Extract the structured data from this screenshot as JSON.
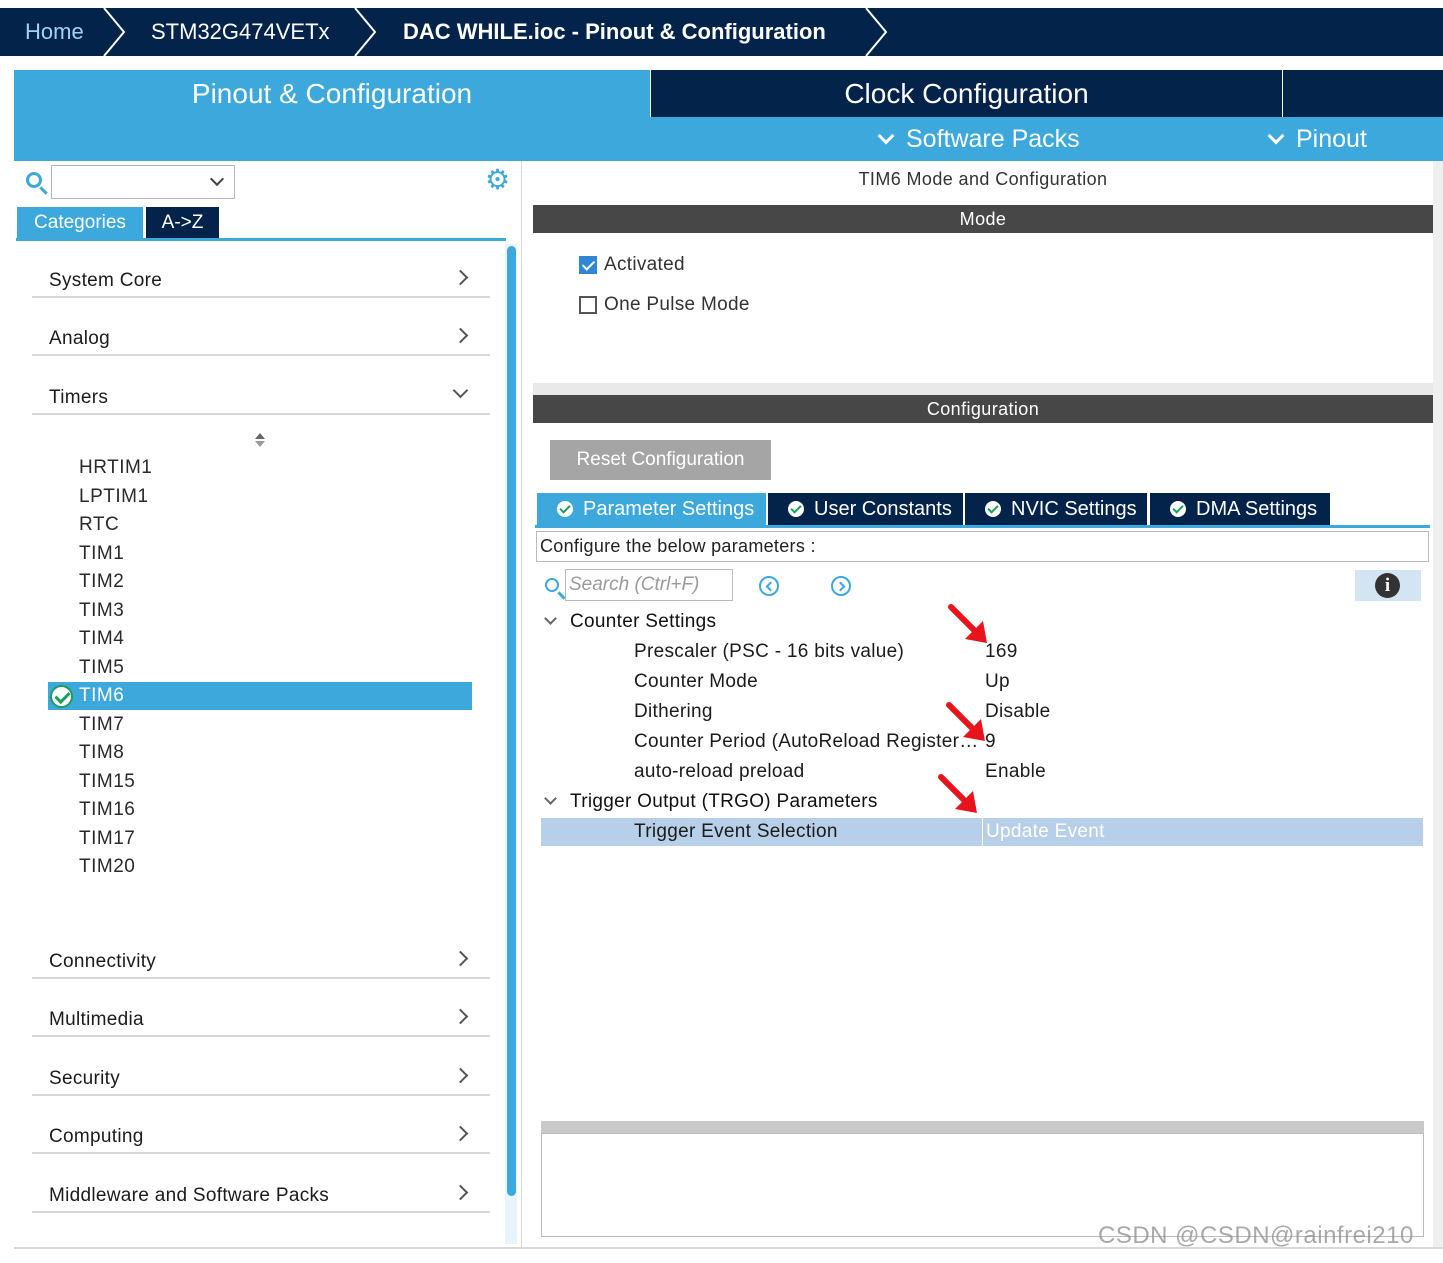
{
  "breadcrumb": {
    "home": "Home",
    "device": "STM32G474VETx",
    "project": "DAC WHILE.ioc - Pinout & Configuration"
  },
  "main_tabs": {
    "pinout_config": "Pinout & Configuration",
    "clock_config": "Clock Configuration"
  },
  "sub_menu": {
    "software_packs": "Software Packs",
    "pinout": "Pinout"
  },
  "left": {
    "search_value": "",
    "tab_categories": "Categories",
    "tab_az": "A->Z",
    "categories": [
      {
        "label": "System Core",
        "expanded": false
      },
      {
        "label": "Analog",
        "expanded": false
      },
      {
        "label": "Timers",
        "expanded": true
      },
      {
        "label": "Connectivity",
        "expanded": false
      },
      {
        "label": "Multimedia",
        "expanded": false
      },
      {
        "label": "Security",
        "expanded": false
      },
      {
        "label": "Computing",
        "expanded": false
      },
      {
        "label": "Middleware and Software Packs",
        "expanded": false
      }
    ],
    "timers": [
      "HRTIM1",
      "LPTIM1",
      "RTC",
      "TIM1",
      "TIM2",
      "TIM3",
      "TIM4",
      "TIM5",
      "TIM6",
      "TIM7",
      "TIM8",
      "TIM15",
      "TIM16",
      "TIM17",
      "TIM20"
    ],
    "selected_timer": "TIM6"
  },
  "right": {
    "title": "TIM6 Mode and Configuration",
    "mode_header": "Mode",
    "mode_options": [
      {
        "label": "Activated",
        "checked": true
      },
      {
        "label": "One Pulse Mode",
        "checked": false
      }
    ],
    "config_header": "Configuration",
    "reset_button": "Reset Configuration",
    "param_tabs": [
      "Parameter Settings",
      "User Constants",
      "NVIC Settings",
      "DMA Settings"
    ],
    "active_param_tab": "Parameter Settings",
    "hint": "Configure the below parameters :",
    "search_placeholder": "Search (Ctrl+F)",
    "info_icon": "i",
    "groups": [
      {
        "label": "Counter Settings",
        "params": [
          {
            "name": "Prescaler (PSC - 16 bits value)",
            "value": "169"
          },
          {
            "name": "Counter Mode",
            "value": "Up"
          },
          {
            "name": "Dithering",
            "value": "Disable"
          },
          {
            "name": "Counter Period (AutoReload Register - 16 bits value)",
            "value": "9"
          },
          {
            "name": "auto-reload preload",
            "value": "Enable"
          }
        ]
      },
      {
        "label": "Trigger Output (TRGO) Parameters",
        "params": [
          {
            "name": "Trigger Event Selection",
            "value": "Update Event"
          }
        ]
      }
    ]
  },
  "watermark": "CSDN @CSDN@rainfrei210",
  "colors": {
    "navy": "#03234b",
    "accent_blue": "#3ca8dc",
    "section_gray": "#474747",
    "selected_row": "#b7cfe8",
    "arrow_red": "#e8141c"
  }
}
